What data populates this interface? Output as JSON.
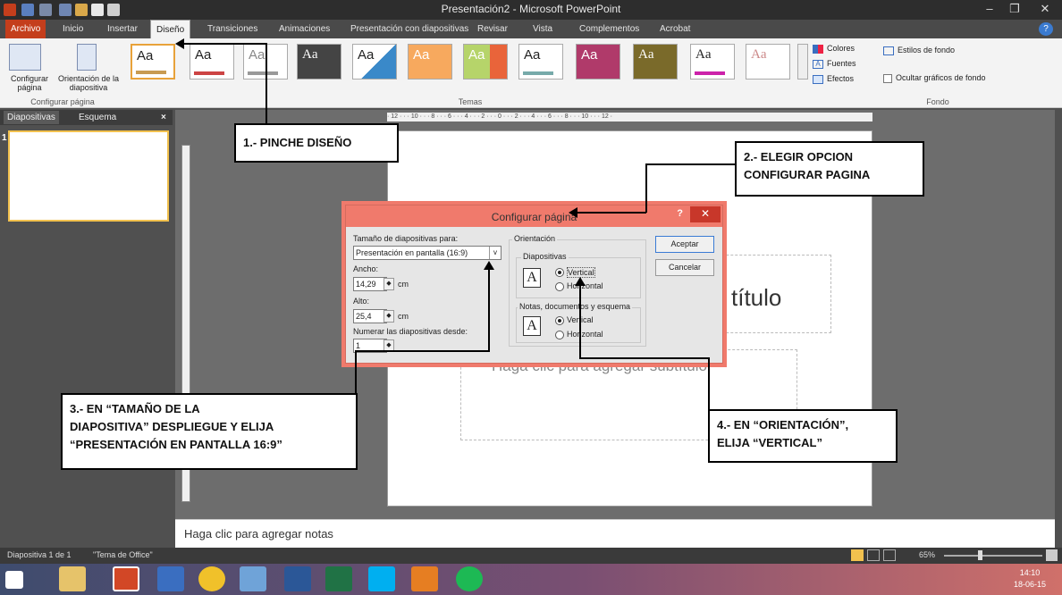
{
  "window": {
    "title": "Presentación2 - Microsoft PowerPoint",
    "minimize": "–",
    "restore": "❐",
    "close": "✕"
  },
  "tabs": [
    "Archivo",
    "Inicio",
    "Insertar",
    "Diseño",
    "Transiciones",
    "Animaciones",
    "Presentación con diapositivas",
    "Revisar",
    "Vista",
    "Complementos",
    "Acrobat"
  ],
  "ribbon": {
    "setup_label": "Configurar página",
    "setup_btn1": "Configurar página",
    "setup_btn2": "Orientación de la diapositiva",
    "themes_label": "Temas",
    "theme_sample": "Aa",
    "colores": "Colores",
    "fuentes": "Fuentes",
    "efectos": "Efectos",
    "estilos": "Estilos de fondo",
    "ocultar": "Ocultar gráficos de fondo",
    "fondo_label": "Fondo"
  },
  "pane": {
    "tab1": "Diapositivas",
    "tab2": "Esquema",
    "close": "×",
    "slide_num": "1"
  },
  "slide": {
    "title_partial": "título",
    "subtitle": "Haga clic para agregar subtítulo"
  },
  "notes": "Haga clic para agregar notas",
  "status": {
    "left": "Diapositiva 1 de 1",
    "theme": "\"Tema de Office\"",
    "zoom": "65%"
  },
  "taskbar": {
    "time": "14:10",
    "date": "18-06-15"
  },
  "dialog": {
    "title": "Configurar página",
    "help": "?",
    "close": "✕",
    "size_label": "Tamaño de diapositivas para:",
    "size_value": "Presentación en pantalla (16:9)",
    "ancho_label": "Ancho:",
    "ancho_value": "14,29",
    "alto_label": "Alto:",
    "alto_value": "25,4",
    "unit": "cm",
    "numerar_label": "Numerar las diapositivas desde:",
    "numerar_value": "1",
    "orient_label": "Orientación",
    "diapositivas_label": "Diapositivas",
    "vertical": "Vertical",
    "horizontal": "Horizontal",
    "notas_label": "Notas, documentos y esquema",
    "aceptar": "Aceptar",
    "cancelar": "Cancelar"
  },
  "callouts": {
    "c1": "1.- PINCHE DISEÑO",
    "c2a": "2.- ELEGIR OPCION",
    "c2b": "CONFIGURAR PAGINA",
    "c3a": "3.- EN “TAMAÑO DE LA",
    "c3b": "DIAPOSITIVA” DESPLIEGUE Y ELIJA",
    "c3c": "“PRESENTACIÓN EN PANTALLA 16:9”",
    "c4a": "4.- EN “ORIENTACIÓN”,",
    "c4b": "ELIJA “VERTICAL”"
  },
  "colors": {
    "file_tab": "#c43e1c",
    "dialog_accent": "#f07a6c",
    "close_red": "#c8372a"
  }
}
